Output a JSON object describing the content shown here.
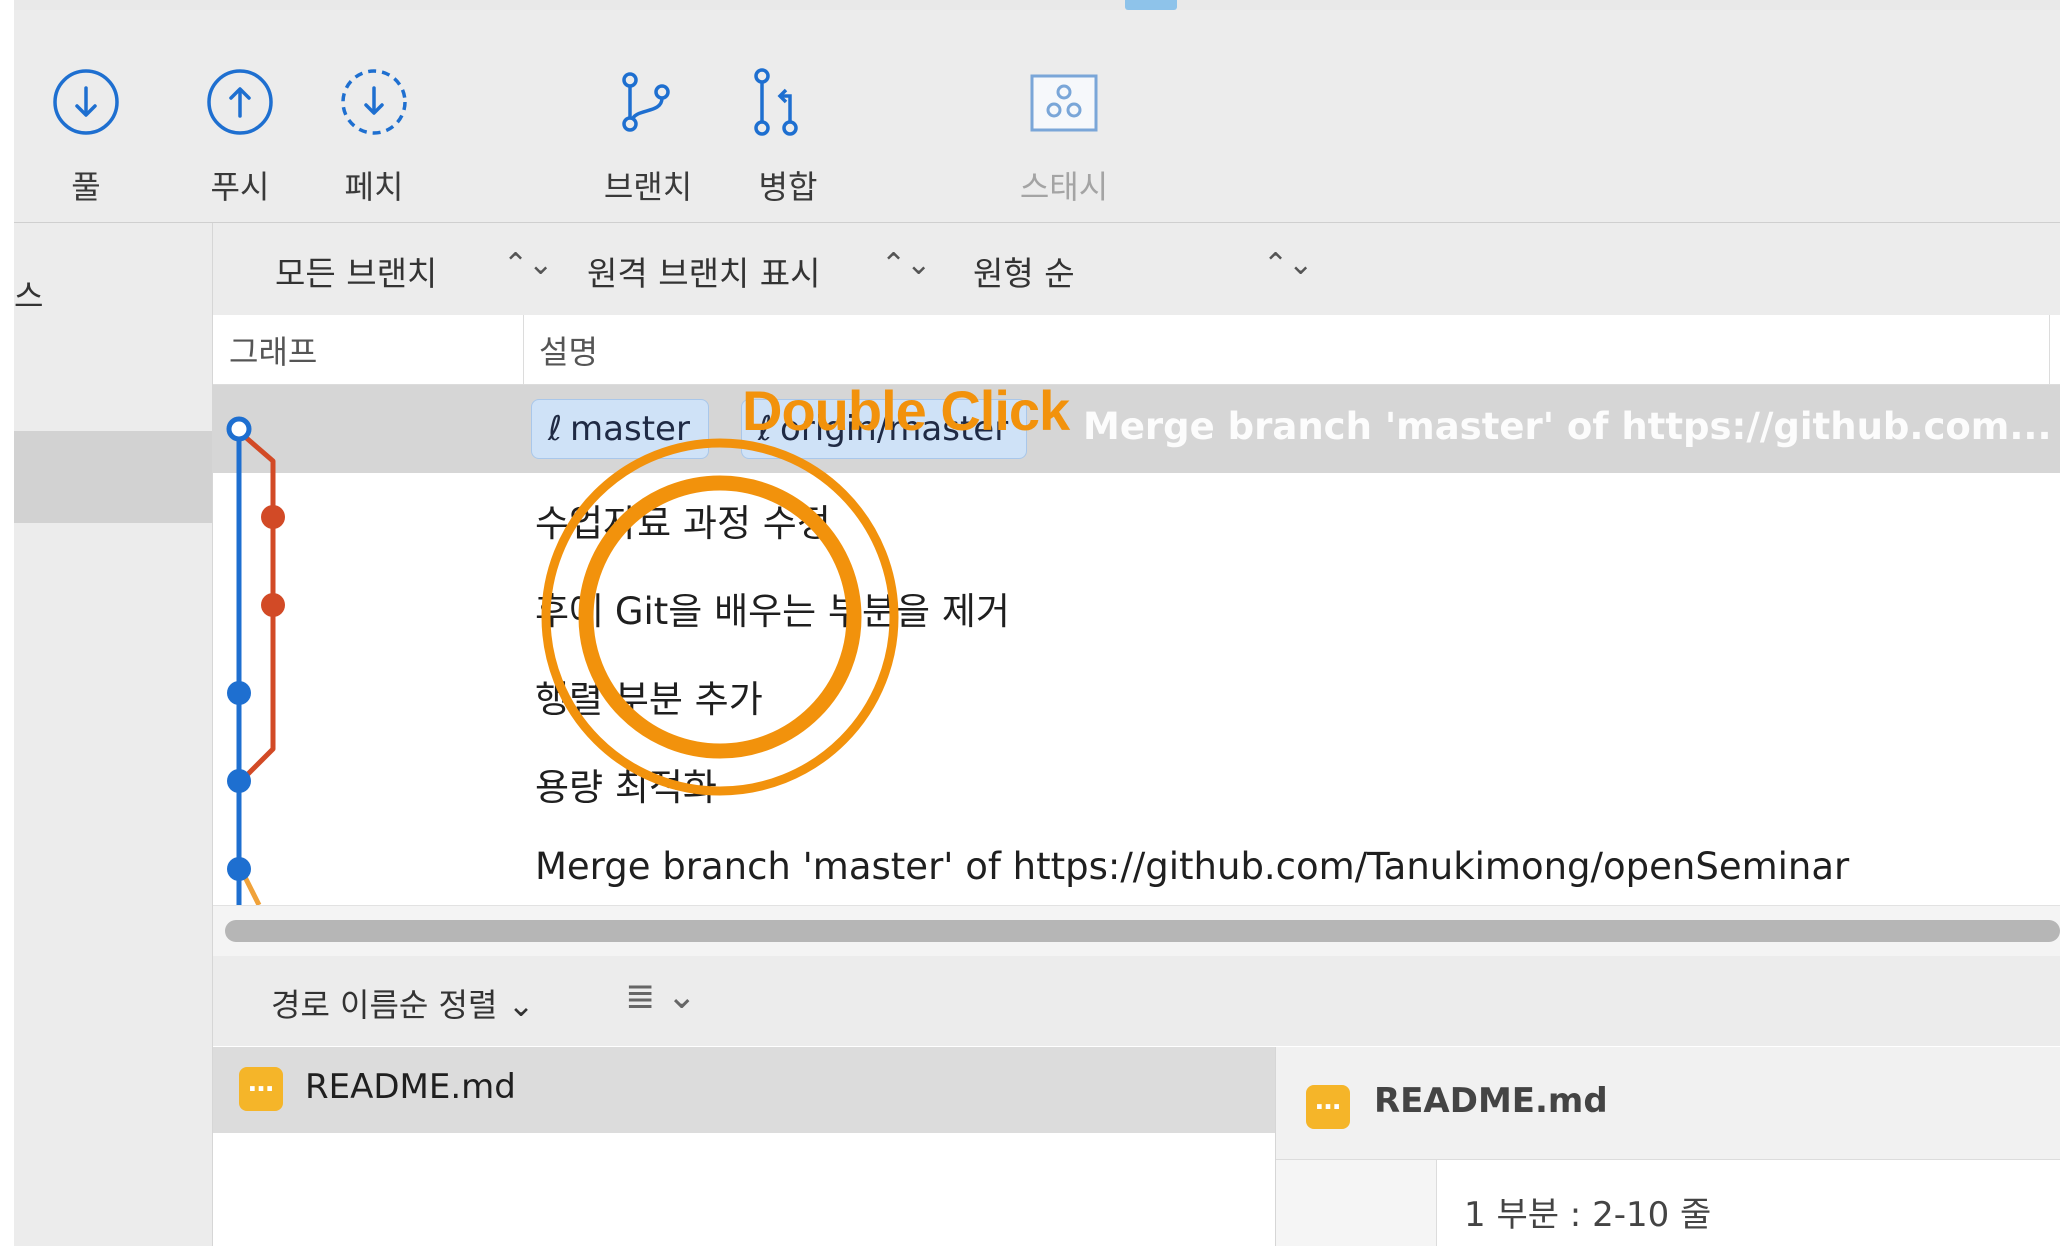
{
  "window": {
    "title": ""
  },
  "toolbar": {
    "pull_label": "풀",
    "push_label": "푸시",
    "fetch_label": "페치",
    "branch_label": "브랜치",
    "merge_label": "병합",
    "stash_label": "스태시"
  },
  "sidebar": {
    "label": "스"
  },
  "filters": {
    "branch_filter": "모든 브랜치",
    "remote_filter": "원격 브랜치 표시",
    "order_filter": "원형 순",
    "caret": "⌃⌄"
  },
  "columns": {
    "graph": "그래프",
    "description": "설명"
  },
  "commits": [
    {
      "message": "Merge branch 'master' of https://github.com...",
      "branches": [
        "master",
        "origin/master"
      ],
      "selected": true
    },
    {
      "message": "수업자료 과정 수정"
    },
    {
      "message": "후에 Git을 배우는 부분을 제거"
    },
    {
      "message": "행렬 부분 추가"
    },
    {
      "message": "용량 최적화"
    },
    {
      "message": "Merge branch 'master' of https://github.com/Tanukimong/openSeminar"
    }
  ],
  "filebar": {
    "sort_label": "경로 이름순 정렬 ⌄",
    "list_icon": "≣ ⌄"
  },
  "files": [
    {
      "name": "README.md"
    }
  ],
  "diff": {
    "file_name": "README.md",
    "hunk": "1 부분 : 2-10 줄"
  },
  "annotation": {
    "text": "Double Click",
    "color": "#f2920c"
  },
  "colors": {
    "accent_blue": "#1e6fd0",
    "branch_red": "#d24a26",
    "branch_orange": "#f0a23a",
    "file_icon": "#f5b529"
  },
  "icons": {
    "pull": "arrow-down-circle-icon",
    "push": "arrow-up-circle-icon",
    "fetch": "dashed-arrow-down-circle-icon",
    "branch": "branch-icon",
    "merge": "merge-icon",
    "stash": "stash-icon"
  }
}
